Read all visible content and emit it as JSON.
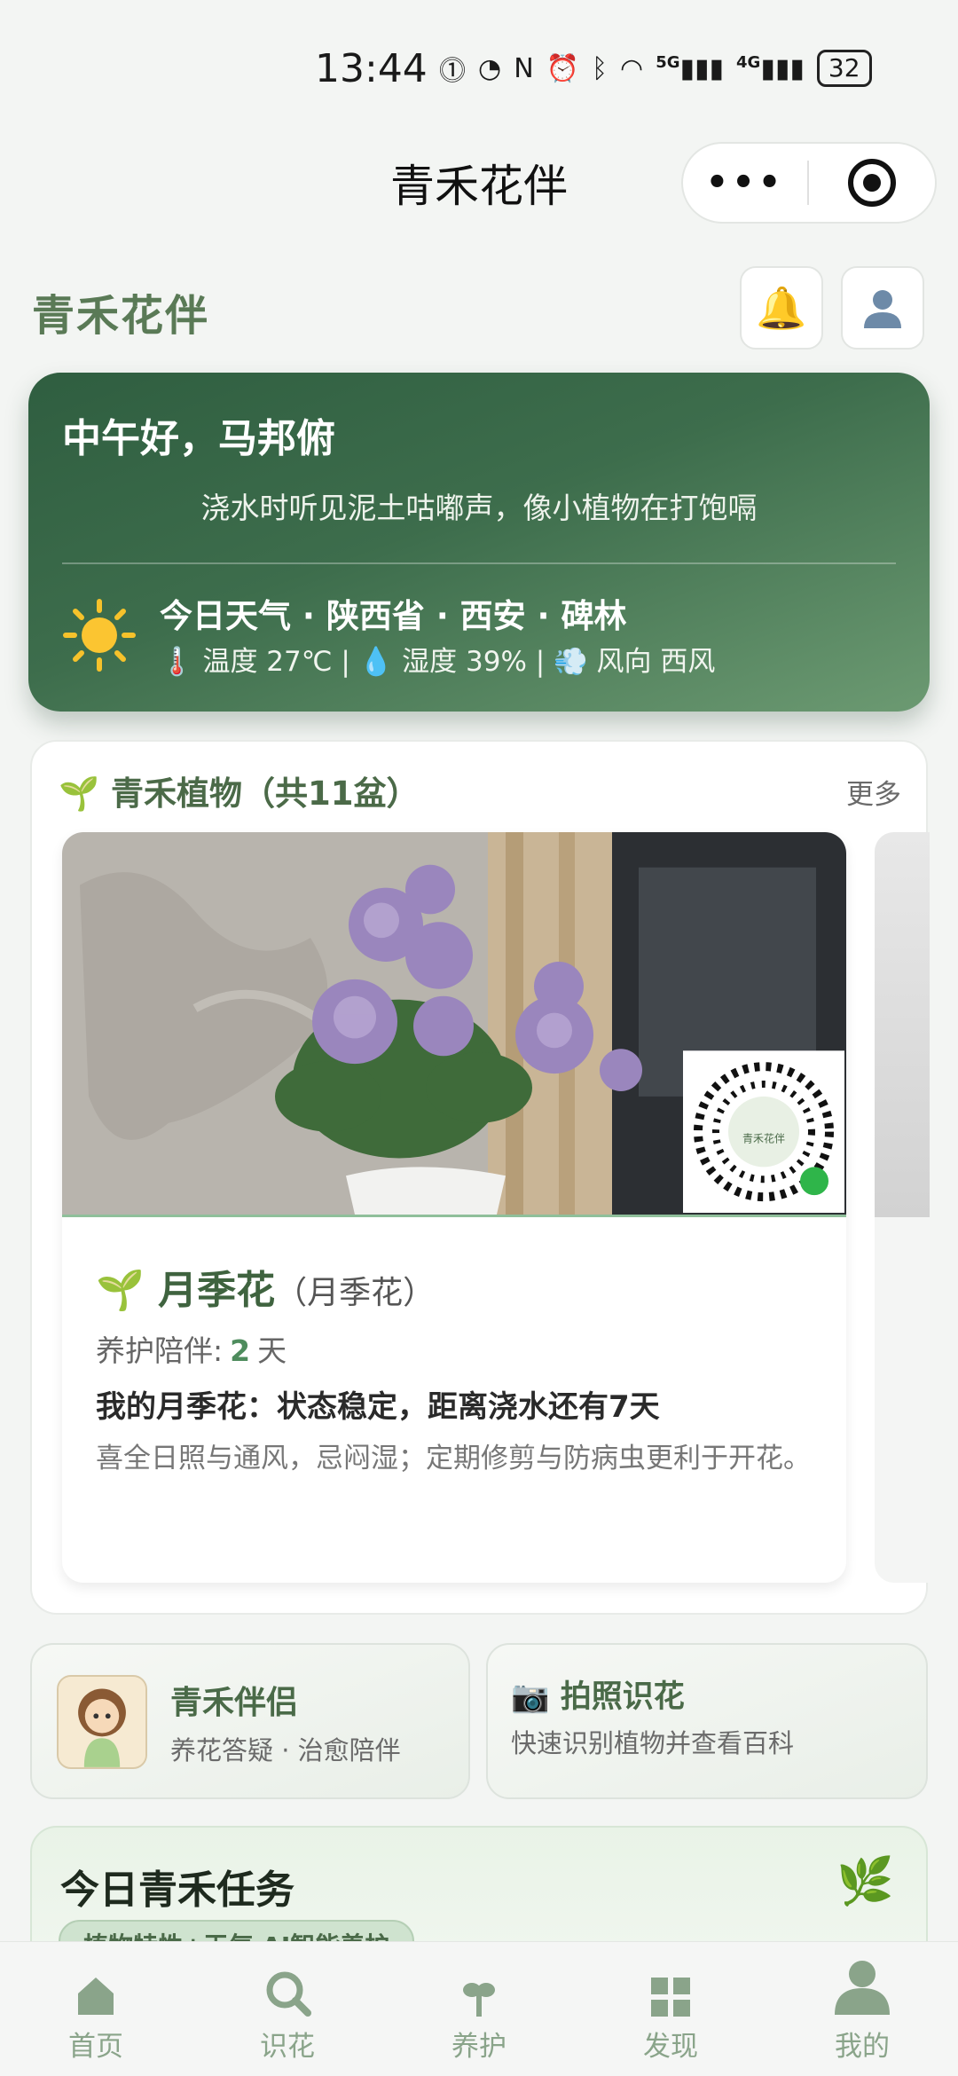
{
  "status": {
    "time": "13:44",
    "battery": "32",
    "net1": "5G",
    "net2": "4G"
  },
  "titlebar": {
    "title": "青禾花伴",
    "more": "•••"
  },
  "header": {
    "brand": "青禾花伴",
    "bell_icon": "bell-icon",
    "user_icon": "user-icon"
  },
  "greeting": {
    "title": "中午好，马邦俯",
    "quote": "浇水时听见泥土咕嘟声，像小植物在打饱嗝",
    "weather_title": "今日天气 · 陕西省 · 西安 · 碑林",
    "weather_detail": "🌡️ 温度 27℃ | 💧 湿度 39% | 💨 风向 西风"
  },
  "plants": {
    "title": "🌱 青禾植物（共11盆）",
    "more": "更多",
    "card": {
      "name": "🌱 月季花",
      "alias": "（月季花）",
      "days_label": "养护陪伴:",
      "days_value": "2",
      "days_unit": "天",
      "status": "我的月季花：状态稳定，距离浇水还有7天",
      "tip": "喜全日照与通风，忌闷湿；定期修剪与防病虫更利于开花。",
      "qr_label": "青禾花伴"
    }
  },
  "quick": {
    "companion_title": "青禾伴侣",
    "companion_sub": "养花答疑 · 治愈陪伴",
    "identify_title": "📷 拍照识花",
    "identify_sub": "快速识别植物并查看百科"
  },
  "tasks": {
    "title": "今日青禾任务",
    "chip": "植物特性+天气 AI智能养护"
  },
  "tabbar": [
    {
      "label": "首页",
      "icon": "home-icon"
    },
    {
      "label": "识花",
      "icon": "search-icon"
    },
    {
      "label": "养护",
      "icon": "sprout-icon"
    },
    {
      "label": "发现",
      "icon": "grid-icon"
    },
    {
      "label": "我的",
      "icon": "person-icon"
    }
  ],
  "colors": {
    "brand": "#5a7a56",
    "card_dark": "#2f5e40",
    "tab": "#8aa48a"
  }
}
